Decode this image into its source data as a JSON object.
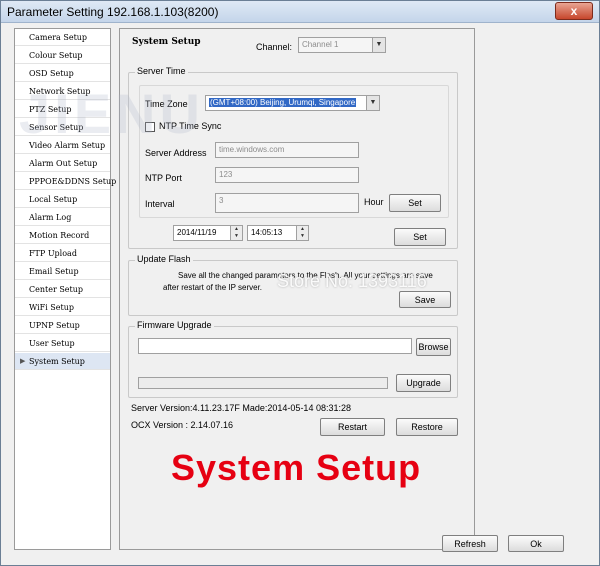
{
  "window": {
    "title": "Parameter Setting 192.168.1.103(8200)",
    "close": "x"
  },
  "sidebar": {
    "items": [
      {
        "label": "Camera Setup"
      },
      {
        "label": "Colour Setup"
      },
      {
        "label": "OSD Setup"
      },
      {
        "label": "Network Setup"
      },
      {
        "label": "PTZ Setup"
      },
      {
        "label": "Sensor Setup"
      },
      {
        "label": "Video Alarm Setup"
      },
      {
        "label": "Alarm Out Setup"
      },
      {
        "label": "PPPOE&DDNS Setup"
      },
      {
        "label": "Local Setup"
      },
      {
        "label": "Alarm Log"
      },
      {
        "label": "Motion Record"
      },
      {
        "label": "FTP Upload"
      },
      {
        "label": "Email Setup"
      },
      {
        "label": "Center Setup"
      },
      {
        "label": "WiFi Setup"
      },
      {
        "label": "UPNP Setup"
      },
      {
        "label": "User Setup"
      },
      {
        "label": "System Setup"
      }
    ],
    "active_index": 18
  },
  "content": {
    "heading": "System Setup",
    "channel_label": "Channel:",
    "channel_value": "Channel 1",
    "server_time": {
      "group_label": "Server Time",
      "timezone_label": "Time Zone",
      "timezone_value": "(GMT+08:00) Beijing, Urumqi, Singapore",
      "ntp_label": "NTP Time Sync",
      "server_address_label": "Server Address",
      "server_address_value": "time.windows.com",
      "ntp_port_label": "NTP Port",
      "ntp_port_value": "123",
      "interval_label": "Interval",
      "interval_value": "3",
      "hour_label": "Hour",
      "set_label": "Set",
      "date_value": "2014/11/19",
      "time_value": "14:05:13",
      "set2_label": "Set"
    },
    "update_flash": {
      "group_label": "Update Flash",
      "text_line1": "Save all the changed parameters to the Flash. All your settings are save",
      "text_line2": "after restart of the IP server.",
      "save_label": "Save"
    },
    "firmware": {
      "group_label": "Firmware Upgrade",
      "browse_label": "Browse",
      "upgrade_label": "Upgrade"
    },
    "server_version": "Server Version:4.11.23.17F Made:2014-05-14 08:31:28",
    "ocx_version": "OCX Version : 2.14.07.16",
    "restart_label": "Restart",
    "restore_label": "Restore"
  },
  "overlay": {
    "watermark": "JIENU",
    "store_text": "Store No: 1393116",
    "big_title": "System Setup",
    "big_title_color": "#e60012"
  },
  "footer": {
    "refresh_label": "Refresh",
    "ok_label": "Ok"
  }
}
